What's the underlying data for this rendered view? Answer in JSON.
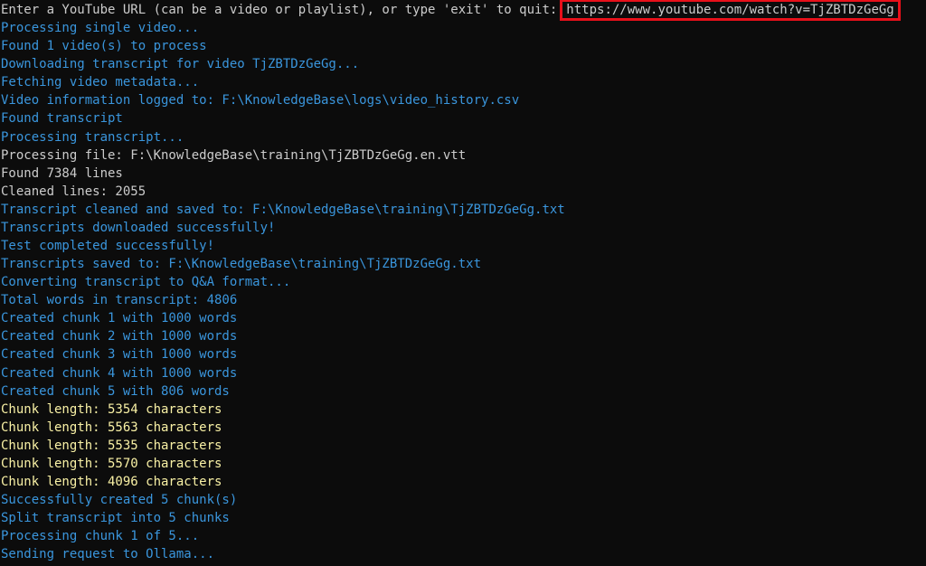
{
  "prompt": {
    "text": "Enter a YouTube URL (can be a video or playlist), or type 'exit' to quit:",
    "input_value": "https://www.youtube.com/watch?v=TjZBTDzGeGg"
  },
  "colors": {
    "white": "#cccccc",
    "cyan": "#3a96dd",
    "yellow": "#f9f1a5",
    "highlight": "#e8101a",
    "background": "#0c0c0c"
  },
  "lines": [
    {
      "text": "Processing single video...",
      "color": "cyan"
    },
    {
      "text": "Found 1 video(s) to process",
      "color": "cyan"
    },
    {
      "text": "Downloading transcript for video TjZBTDzGeGg...",
      "color": "cyan"
    },
    {
      "text": "Fetching video metadata...",
      "color": "cyan"
    },
    {
      "text": "Video information logged to: F:\\KnowledgeBase\\logs\\video_history.csv",
      "color": "cyan"
    },
    {
      "text": "Found transcript",
      "color": "cyan"
    },
    {
      "text": "Processing transcript...",
      "color": "cyan"
    },
    {
      "text": "Processing file: F:\\KnowledgeBase\\training\\TjZBTDzGeGg.en.vtt",
      "color": "white"
    },
    {
      "text": "Found 7384 lines",
      "color": "white"
    },
    {
      "text": "Cleaned lines: 2055",
      "color": "white"
    },
    {
      "text": "Transcript cleaned and saved to: F:\\KnowledgeBase\\training\\TjZBTDzGeGg.txt",
      "color": "cyan"
    },
    {
      "text": "Transcripts downloaded successfully!",
      "color": "cyan"
    },
    {
      "text": "Test completed successfully!",
      "color": "cyan"
    },
    {
      "text": "Transcripts saved to: F:\\KnowledgeBase\\training\\TjZBTDzGeGg.txt",
      "color": "cyan"
    },
    {
      "text": "Converting transcript to Q&A format...",
      "color": "cyan"
    },
    {
      "text": "Total words in transcript: 4806",
      "color": "cyan"
    },
    {
      "text": "Created chunk 1 with 1000 words",
      "color": "cyan"
    },
    {
      "text": "Created chunk 2 with 1000 words",
      "color": "cyan"
    },
    {
      "text": "Created chunk 3 with 1000 words",
      "color": "cyan"
    },
    {
      "text": "Created chunk 4 with 1000 words",
      "color": "cyan"
    },
    {
      "text": "Created chunk 5 with 806 words",
      "color": "cyan"
    },
    {
      "text": "Chunk length: 5354 characters",
      "color": "yellow"
    },
    {
      "text": "Chunk length: 5563 characters",
      "color": "yellow"
    },
    {
      "text": "Chunk length: 5535 characters",
      "color": "yellow"
    },
    {
      "text": "Chunk length: 5570 characters",
      "color": "yellow"
    },
    {
      "text": "Chunk length: 4096 characters",
      "color": "yellow"
    },
    {
      "text": "Successfully created 5 chunk(s)",
      "color": "cyan"
    },
    {
      "text": "Split transcript into 5 chunks",
      "color": "cyan"
    },
    {
      "text": "Processing chunk 1 of 5...",
      "color": "cyan"
    },
    {
      "text": "Sending request to Ollama...",
      "color": "cyan"
    }
  ]
}
